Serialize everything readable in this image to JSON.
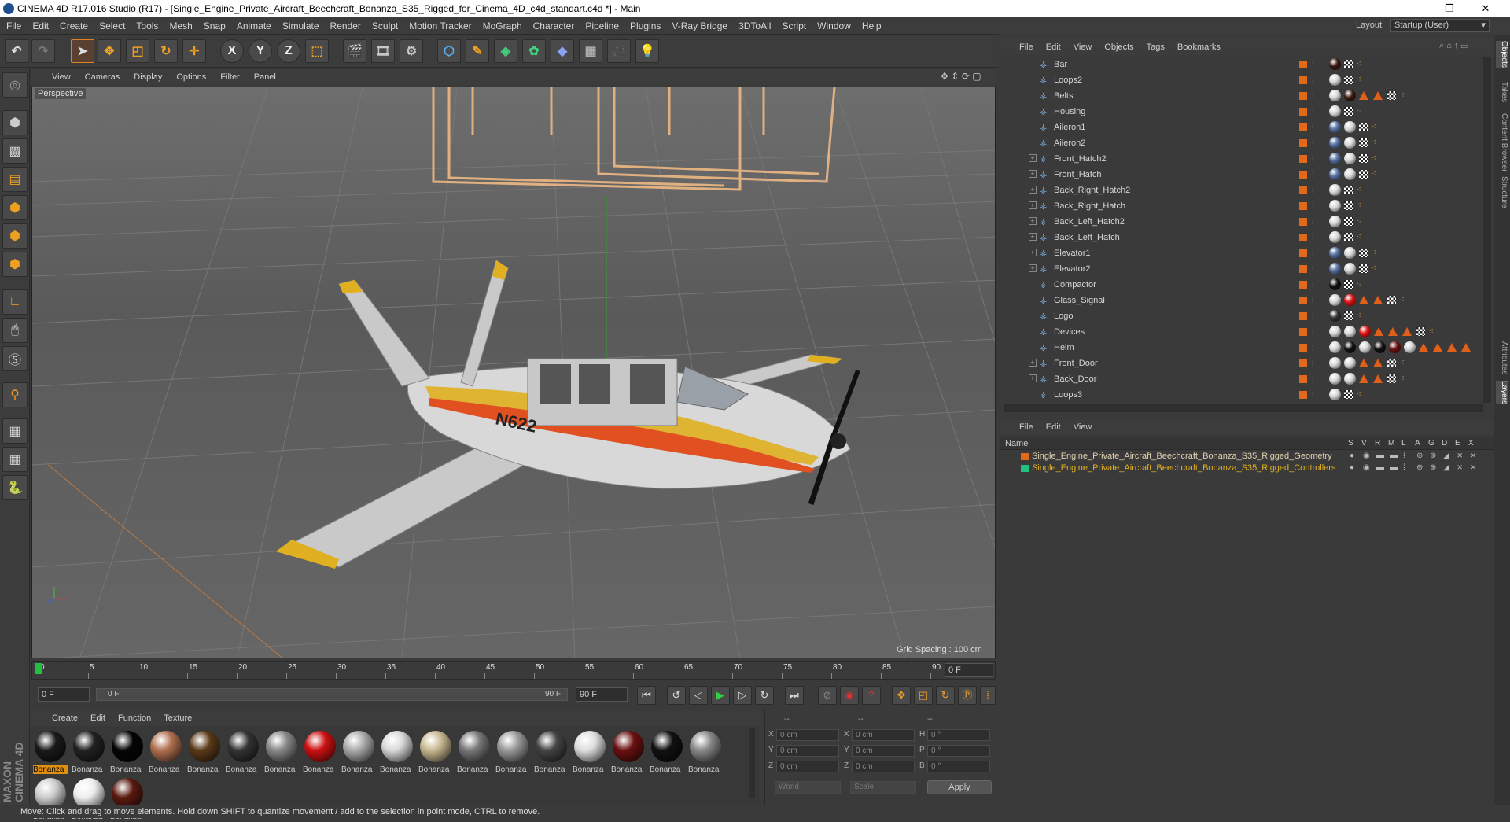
{
  "window": {
    "title": "CINEMA 4D R17.016 Studio (R17) - [Single_Engine_Private_Aircraft_Beechcraft_Bonanza_S35_Rigged_for_Cinema_4D_c4d_standart.c4d *] - Main",
    "min": "—",
    "max": "❐",
    "close": "✕"
  },
  "menu": [
    "File",
    "Edit",
    "Create",
    "Select",
    "Tools",
    "Mesh",
    "Snap",
    "Animate",
    "Simulate",
    "Render",
    "Sculpt",
    "Motion Tracker",
    "MoGraph",
    "Character",
    "Pipeline",
    "Plugins",
    "V-Ray Bridge",
    "3DToAll",
    "Script",
    "Window",
    "Help"
  ],
  "layout": {
    "label": "Layout:",
    "value": "Startup (User)"
  },
  "toolbar": {
    "undo": "↶",
    "redo": "↷",
    "x": "X",
    "y": "Y",
    "z": "Z"
  },
  "viewport": {
    "menu": [
      "View",
      "Cameras",
      "Display",
      "Options",
      "Filter",
      "Panel"
    ],
    "label": "Perspective",
    "grid_spacing": "Grid Spacing : 100 cm",
    "tail_text": "N622"
  },
  "timeline": {
    "ticks": [
      "0",
      "5",
      "10",
      "15",
      "20",
      "25",
      "30",
      "35",
      "40",
      "45",
      "50",
      "55",
      "60",
      "65",
      "70",
      "75",
      "80",
      "85",
      "90"
    ],
    "current": "0 F"
  },
  "transport": {
    "start": "0 F",
    "slider_left": "0 F",
    "slider_right": "90 F",
    "end": "90 F"
  },
  "materials": {
    "menu": [
      "Create",
      "Edit",
      "Function",
      "Texture"
    ],
    "label": "Bonanza",
    "items": [
      {
        "color": "#1a1a1a"
      },
      {
        "color": "#222"
      },
      {
        "color": "#050505"
      },
      {
        "color": "#b07050"
      },
      {
        "color": "#5a3a18"
      },
      {
        "color": "#333"
      },
      {
        "color": "#888"
      },
      {
        "color": "#cc1010"
      },
      {
        "color": "#aaa"
      },
      {
        "color": "#d8d8d8"
      },
      {
        "color": "#c8b890"
      },
      {
        "color": "#777"
      },
      {
        "color": "#999"
      },
      {
        "color": "#444"
      },
      {
        "color": "#ddd"
      },
      {
        "color": "#6a1010"
      },
      {
        "color": "#111"
      },
      {
        "color": "#888"
      },
      {
        "color": "#ccc"
      },
      {
        "color": "#eee"
      },
      {
        "color": "#5a1a10"
      }
    ]
  },
  "coords": {
    "headers": [
      "--",
      "--",
      "--"
    ],
    "rows": [
      {
        "a": "X",
        "av": "0 cm",
        "b": "X",
        "bv": "0 cm",
        "c": "H",
        "cv": "0 °"
      },
      {
        "a": "Y",
        "av": "0 cm",
        "b": "Y",
        "bv": "0 cm",
        "c": "P",
        "cv": "0 °"
      },
      {
        "a": "Z",
        "av": "0 cm",
        "b": "Z",
        "bv": "0 cm",
        "c": "B",
        "cv": "0 °"
      }
    ],
    "mode1": "World",
    "mode2": "Scale",
    "apply": "Apply"
  },
  "status": "Move: Click and drag to move elements. Hold down SHIFT to quantize movement / add to the selection in point mode, CTRL to remove.",
  "objects": {
    "menu": [
      "File",
      "Edit",
      "View",
      "Objects",
      "Tags",
      "Bookmarks"
    ],
    "rows": [
      {
        "name": "Bar",
        "plus": false
      },
      {
        "name": "Loops2",
        "plus": false
      },
      {
        "name": "Belts",
        "plus": false
      },
      {
        "name": "Housing",
        "plus": false
      },
      {
        "name": "Aileron1",
        "plus": false
      },
      {
        "name": "Aileron2",
        "plus": false
      },
      {
        "name": "Front_Hatch2",
        "plus": true
      },
      {
        "name": "Front_Hatch",
        "plus": true
      },
      {
        "name": "Back_Right_Hatch2",
        "plus": true
      },
      {
        "name": "Back_Right_Hatch",
        "plus": true
      },
      {
        "name": "Back_Left_Hatch2",
        "plus": true
      },
      {
        "name": "Back_Left_Hatch",
        "plus": true
      },
      {
        "name": "Elevator1",
        "plus": true
      },
      {
        "name": "Elevator2",
        "plus": true
      },
      {
        "name": "Compactor",
        "plus": false
      },
      {
        "name": "Glass_Signal",
        "plus": false
      },
      {
        "name": "Logo",
        "plus": false
      },
      {
        "name": "Devices",
        "plus": false
      },
      {
        "name": "Helm",
        "plus": false
      },
      {
        "name": "Front_Door",
        "plus": true
      },
      {
        "name": "Back_Door",
        "plus": true
      },
      {
        "name": "Loops3",
        "plus": false
      }
    ]
  },
  "layers": {
    "menu": [
      "File",
      "Edit",
      "View"
    ],
    "header": {
      "name": "Name",
      "cols": [
        "S",
        "V",
        "R",
        "M",
        "L",
        "A",
        "G",
        "D",
        "E",
        "X"
      ]
    },
    "rows": [
      {
        "name": "Single_Engine_Private_Aircraft_Beechcraft_Bonanza_S35_Rigged_Geometry",
        "color": "#e06a1a",
        "text": "#e0d0b0"
      },
      {
        "name": "Single_Engine_Private_Aircraft_Beechcraft_Bonanza_S35_Rigged_Controllers",
        "color": "#20c080",
        "text": "#e0b020"
      }
    ]
  },
  "sidetabs": [
    "Objects",
    "Takes",
    "Content Browser",
    "Structure",
    "Attributes",
    "Layers"
  ],
  "brand": "MAXON CINEMA 4D"
}
